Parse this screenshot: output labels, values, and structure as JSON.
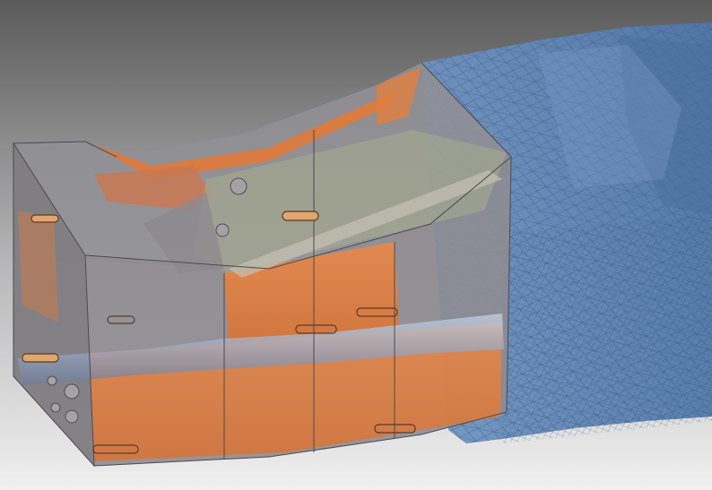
{
  "viewport": {
    "background_top": "#5c5c5c",
    "background_bottom": "#ececec",
    "model_colors": {
      "housing_gray": "#8f8e93",
      "housing_front": "#7f7d82",
      "orange_part": "#e1803f",
      "blue_mesh": "#5f86b8",
      "mesh_line": "#3f5f8a",
      "green_part": "#a9b48d"
    }
  }
}
